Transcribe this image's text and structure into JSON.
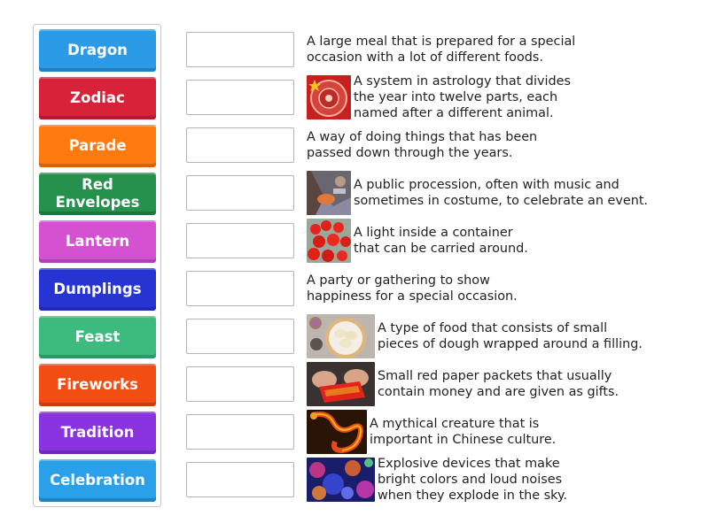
{
  "tiles": [
    {
      "label": "Dragon",
      "color": "#2b9be8"
    },
    {
      "label": "Zodiac",
      "color": "#d8223a"
    },
    {
      "label": "Parade",
      "color": "#ff7a10"
    },
    {
      "label": "Red Envelopes",
      "color": "#25914c"
    },
    {
      "label": "Lantern",
      "color": "#d452d2"
    },
    {
      "label": "Dumplings",
      "color": "#2634d4"
    },
    {
      "label": "Feast",
      "color": "#3dba7e"
    },
    {
      "label": "Fireworks",
      "color": "#f24e14"
    },
    {
      "label": "Tradition",
      "color": "#8a33e0"
    },
    {
      "label": "Celebration",
      "color": "#2aa0e8"
    }
  ],
  "definitions": [
    {
      "text": "A large meal that is prepared for a special\noccasion with a lot of different foods.",
      "image": null
    },
    {
      "text": "A system in astrology that divides\nthe year into twelve parts, each\nnamed after a different animal.",
      "image": "zodiac-wheel"
    },
    {
      "text": "A way of doing things that has been\npassed down through the years.",
      "image": null
    },
    {
      "text": "A public procession, often with music and\nsometimes in costume, to celebrate an event.",
      "image": "parade-photo"
    },
    {
      "text": "A light inside a container\nthat can be carried around.",
      "image": "red-lanterns"
    },
    {
      "text": "A party or gathering to show\nhappiness for a special occasion.",
      "image": null
    },
    {
      "text": "A type of food that consists of small\npieces of dough wrapped around a filling.",
      "image": "dumplings-photo"
    },
    {
      "text": "Small red paper packets that usually\ncontain money and are given as gifts.",
      "image": "red-envelope-photo"
    },
    {
      "text": "A mythical creature that is\nimportant in Chinese culture.",
      "image": "dragon-picture"
    },
    {
      "text": "Explosive devices that make\nbright colors and loud noises\nwhen they explode in the sky.",
      "image": "fireworks-photo"
    }
  ]
}
